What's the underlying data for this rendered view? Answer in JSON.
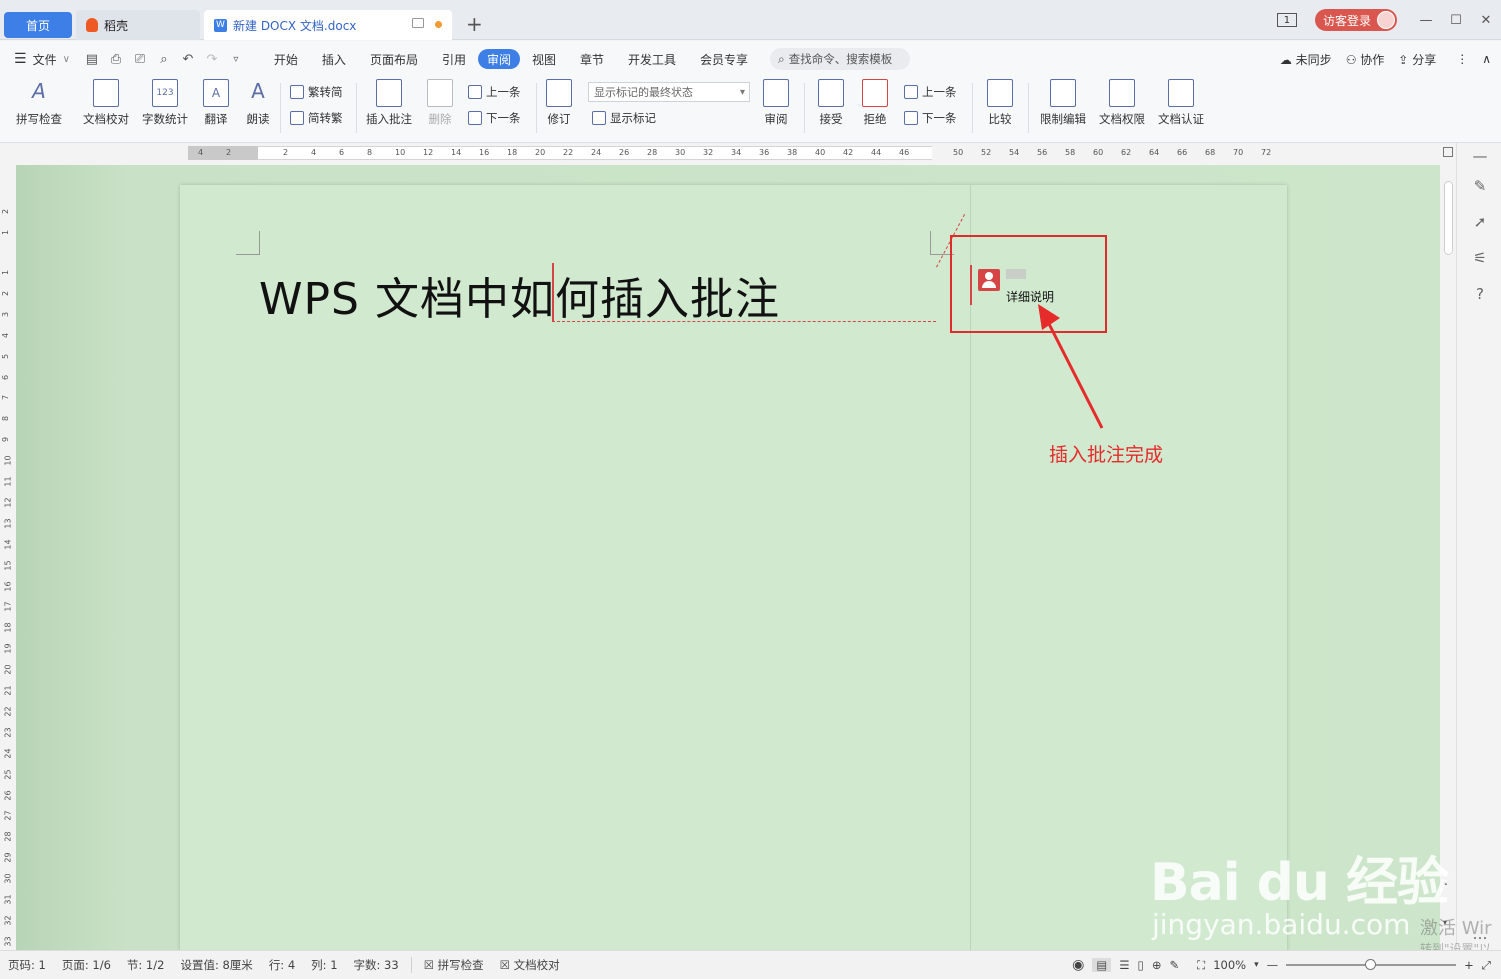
{
  "tabs": {
    "home": "首页",
    "daoke": "稻壳",
    "document": "新建 DOCX 文档.docx",
    "tab_count": "1",
    "login": "访客登录"
  },
  "menu": {
    "file": "文件",
    "items": [
      "开始",
      "插入",
      "页面布局",
      "引用",
      "审阅",
      "视图",
      "章节",
      "开发工具",
      "会员专享"
    ],
    "active": "审阅",
    "search_placeholder": "查找命令、搜索模板",
    "unsynced": "未同步",
    "collaborate": "协作",
    "share": "分享"
  },
  "toolbar": {
    "spell_check": "拼写检查",
    "doc_proof": "文档校对",
    "word_count": "字数统计",
    "translate": "翻译",
    "read_aloud": "朗读",
    "trad_to_simp": "繁转简",
    "simp_to_trad": "简转繁",
    "insert_comment": "插入批注",
    "delete": "删除",
    "prev": "上一条",
    "next": "下一条",
    "track_changes": "修订",
    "markup_state": "显示标记的最终状态",
    "show_markup": "显示标记",
    "review": "审阅",
    "accept": "接受",
    "reject": "拒绝",
    "prev2": "上一条",
    "next2": "下一条",
    "compare": "比较",
    "restrict_edit": "限制编辑",
    "doc_permission": "文档权限",
    "doc_certify": "文档认证"
  },
  "ruler": {
    "h_left": [
      "4",
      "2"
    ],
    "h_main": [
      "2",
      "4",
      "6",
      "8",
      "10",
      "12",
      "14",
      "16",
      "18",
      "20",
      "22",
      "24",
      "26",
      "28",
      "30",
      "32",
      "34",
      "36",
      "38",
      "40",
      "42",
      "44",
      "46"
    ],
    "h_right": [
      "50",
      "52",
      "54",
      "56",
      "58",
      "60",
      "62",
      "64",
      "66",
      "68",
      "70",
      "72"
    ],
    "v_top": [
      "2",
      "1"
    ],
    "v_main": [
      "1",
      "2",
      "3",
      "4",
      "5",
      "6",
      "7",
      "8",
      "9",
      "10",
      "11",
      "12",
      "13",
      "14",
      "15",
      "16",
      "17",
      "18",
      "19",
      "20",
      "21",
      "22",
      "23",
      "24",
      "25",
      "26",
      "27",
      "28",
      "29",
      "30",
      "31",
      "32",
      "33"
    ]
  },
  "document": {
    "heading": "WPS 文档中如何插入批注",
    "comment_text": "详细说明"
  },
  "annotation": {
    "label": "插入批注完成",
    "color": "#e62b2b"
  },
  "status": {
    "page_num": "页码: 1",
    "pages": "页面: 1/6",
    "section": "节: 1/2",
    "setting": "设置值: 8厘米",
    "line": "行: 4",
    "column": "列: 1",
    "word_count": "字数: 33",
    "spell_check": "拼写检查",
    "doc_proof": "文档校对",
    "zoom": "100%",
    "zoom_fraction": 0.5
  },
  "watermark": {
    "logo": "Bai du 经验",
    "url": "jingyan.baidu.com",
    "activate": "激活 Wir",
    "activate_sub": "转到\"设置\"以"
  }
}
